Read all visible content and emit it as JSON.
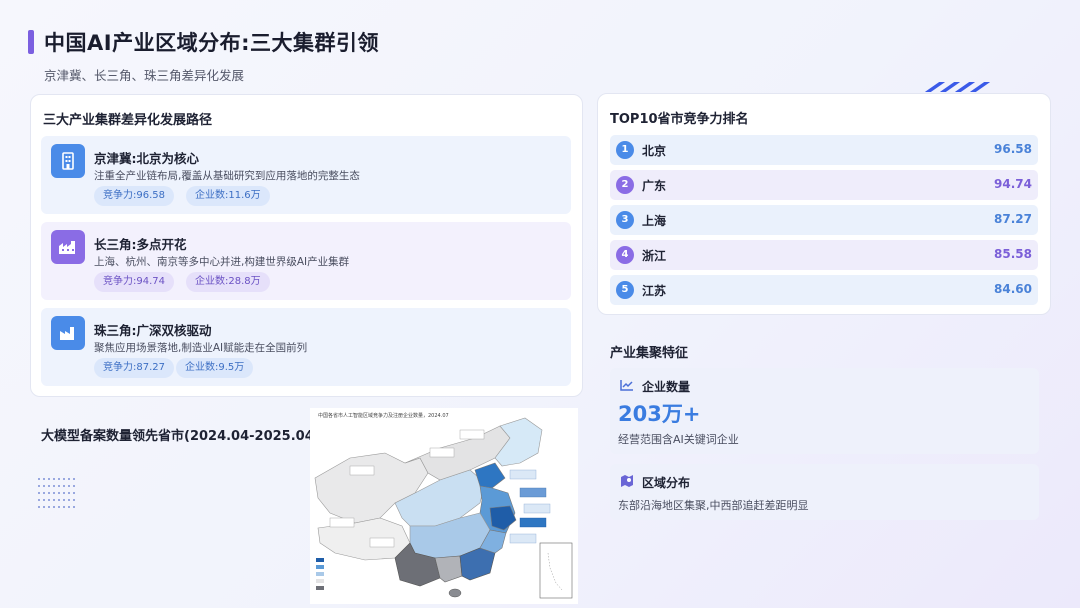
{
  "header": {
    "title": "中国AI产业区域分布:三大集群引领",
    "subtitle": "京津冀、长三角、珠三角差异化发展"
  },
  "clusters_section": {
    "title": "三大产业集群差异化发展路径",
    "items": [
      {
        "name": "京津冀:北京为核心",
        "desc": "注重全产业链布局,覆盖从基础研究到应用落地的完整生态",
        "score_label": "竞争力:96.58",
        "firms_label": "企业数:11.6万",
        "icon": "building-icon",
        "theme": "blue"
      },
      {
        "name": "长三角:多点开花",
        "desc": "上海、杭州、南京等多中心并进,构建世界级AI产业集群",
        "score_label": "竞争力:94.74",
        "firms_label": "企业数:28.8万",
        "icon": "city-icon",
        "theme": "purple"
      },
      {
        "name": "珠三角:广深双核驱动",
        "desc": "聚焦应用场景落地,制造业AI赋能走在全国前列",
        "score_label": "竞争力:87.27",
        "firms_label": "企业数:9.5万",
        "icon": "factory-icon",
        "theme": "blue"
      }
    ]
  },
  "ranking": {
    "title": "TOP10省市竞争力排名",
    "rows": [
      {
        "rank": "1",
        "name": "北京",
        "score": "96.58",
        "theme": "blue"
      },
      {
        "rank": "2",
        "name": "广东",
        "score": "94.74",
        "theme": "purple"
      },
      {
        "rank": "3",
        "name": "上海",
        "score": "87.27",
        "theme": "blue"
      },
      {
        "rank": "4",
        "name": "浙江",
        "score": "85.58",
        "theme": "purple"
      },
      {
        "rank": "5",
        "name": "江苏",
        "score": "84.60",
        "theme": "blue"
      }
    ]
  },
  "features": {
    "title": "产业集聚特征",
    "count_box": {
      "label": "企业数量",
      "value": "203万+",
      "note": "经营范围含AI关键词企业",
      "icon": "trend-chart-icon"
    },
    "region_box": {
      "label": "区域分布",
      "note": "东部沿海地区集聚,中西部追赶差距明显",
      "icon": "map-pin-icon"
    }
  },
  "map_section": {
    "title": "大模型备案数量领先省市(2024.04-2025.04)",
    "caption": "中国各省市人工智能区域竞争力及注册企业数量，2024.07"
  },
  "colors": {
    "accent_purple": "#7b5fe0",
    "accent_blue": "#4a8be8",
    "score_blue": "#4a82d8",
    "big_number": "#3a7ce0"
  }
}
